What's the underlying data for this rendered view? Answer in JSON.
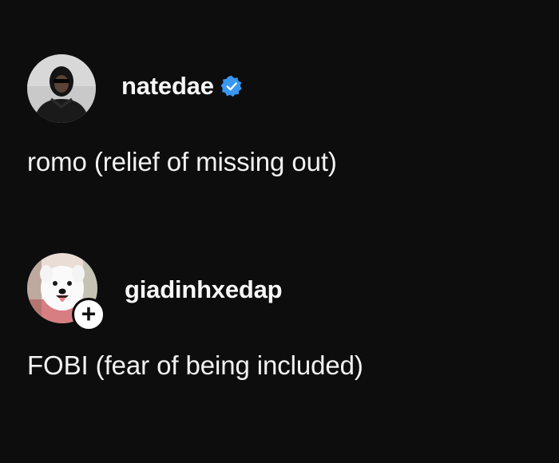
{
  "comments": [
    {
      "username": "natedae",
      "verified": true,
      "avatar_icon": "person-in-dark-hood-avatar",
      "text": "romo (relief of missing out)"
    },
    {
      "username": "giadinhxedap",
      "verified": false,
      "avatar_icon": "white-dog-avatar",
      "follow_badge": "+",
      "text": "FOBI (fear of being included)"
    }
  ],
  "colors": {
    "background": "#0d0d0e",
    "text": "#f5f5f5",
    "verified_badge": "#3897f0"
  }
}
